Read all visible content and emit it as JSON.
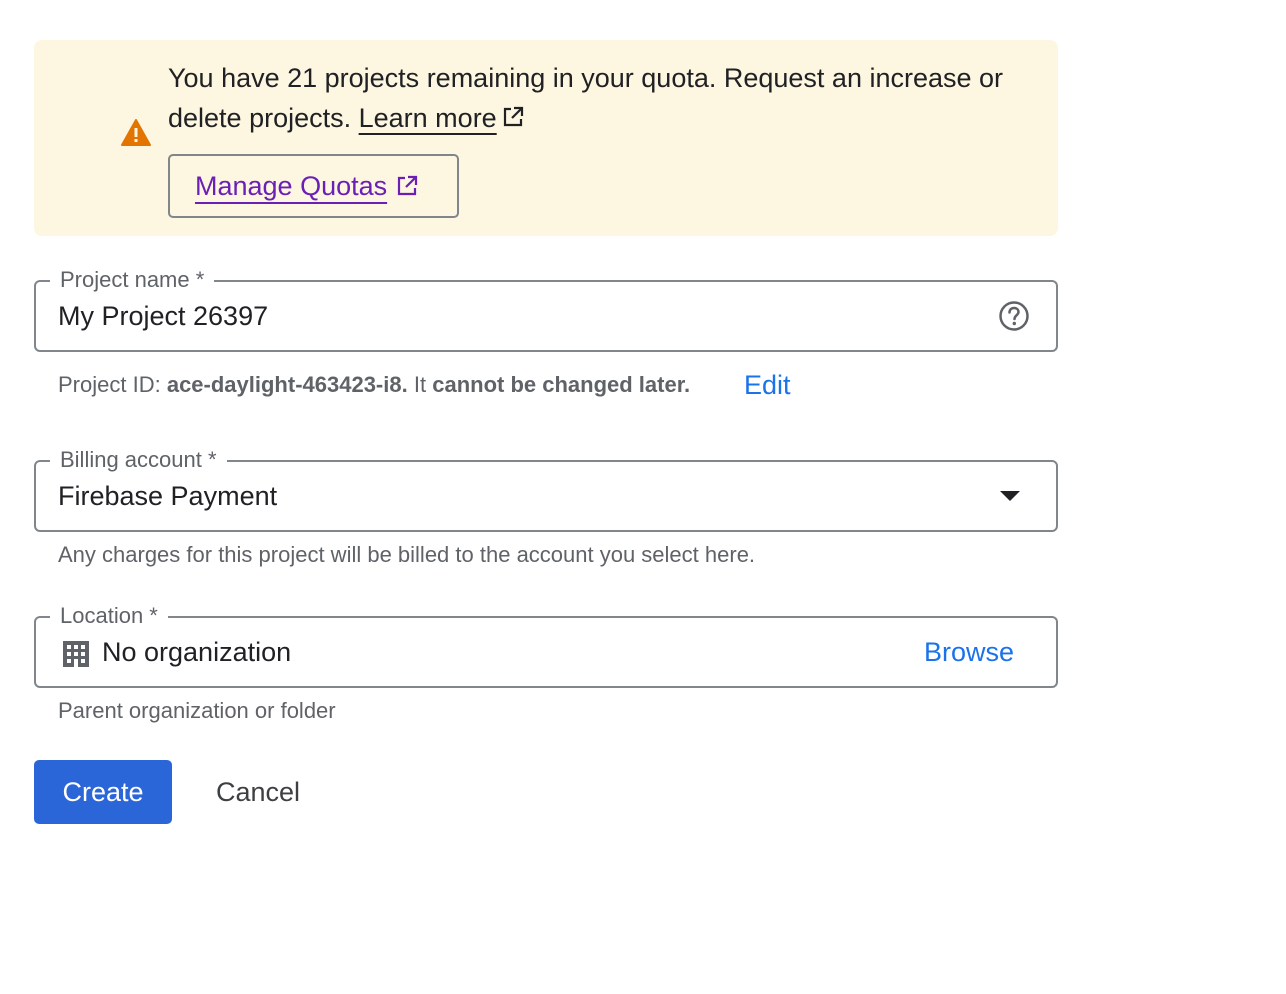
{
  "quota_banner": {
    "message": "You have 21 projects remaining in your quota. Request an increase or delete projects.",
    "learn_more_label": "Learn more",
    "manage_quotas_label": "Manage Quotas",
    "warning_icon": "warning-icon",
    "external_link_icon": "external-link-icon"
  },
  "project_name": {
    "label": "Project name *",
    "value": "My Project 26397",
    "help_icon": "help-circle-icon"
  },
  "project_id": {
    "prefix": "Project ID:",
    "id": "ace-daylight-463423-i8.",
    "middle": "It",
    "suffix": "cannot be changed later.",
    "edit_label": "Edit"
  },
  "billing_account": {
    "label": "Billing account *",
    "value": "Firebase Payment",
    "helper": "Any charges for this project will be billed to the account you select here.",
    "dropdown_icon": "dropdown-arrow-icon"
  },
  "location": {
    "label": "Location *",
    "value": "No organization",
    "browse_label": "Browse",
    "helper": "Parent organization or folder",
    "icon": "building-icon"
  },
  "actions": {
    "create_label": "Create",
    "cancel_label": "Cancel"
  },
  "colors": {
    "banner_bg": "#fdf6e0",
    "warning": "#e37400",
    "link_purple": "#6a1fb6",
    "link_blue": "#1a73e8",
    "primary_button": "#2b66d9"
  }
}
